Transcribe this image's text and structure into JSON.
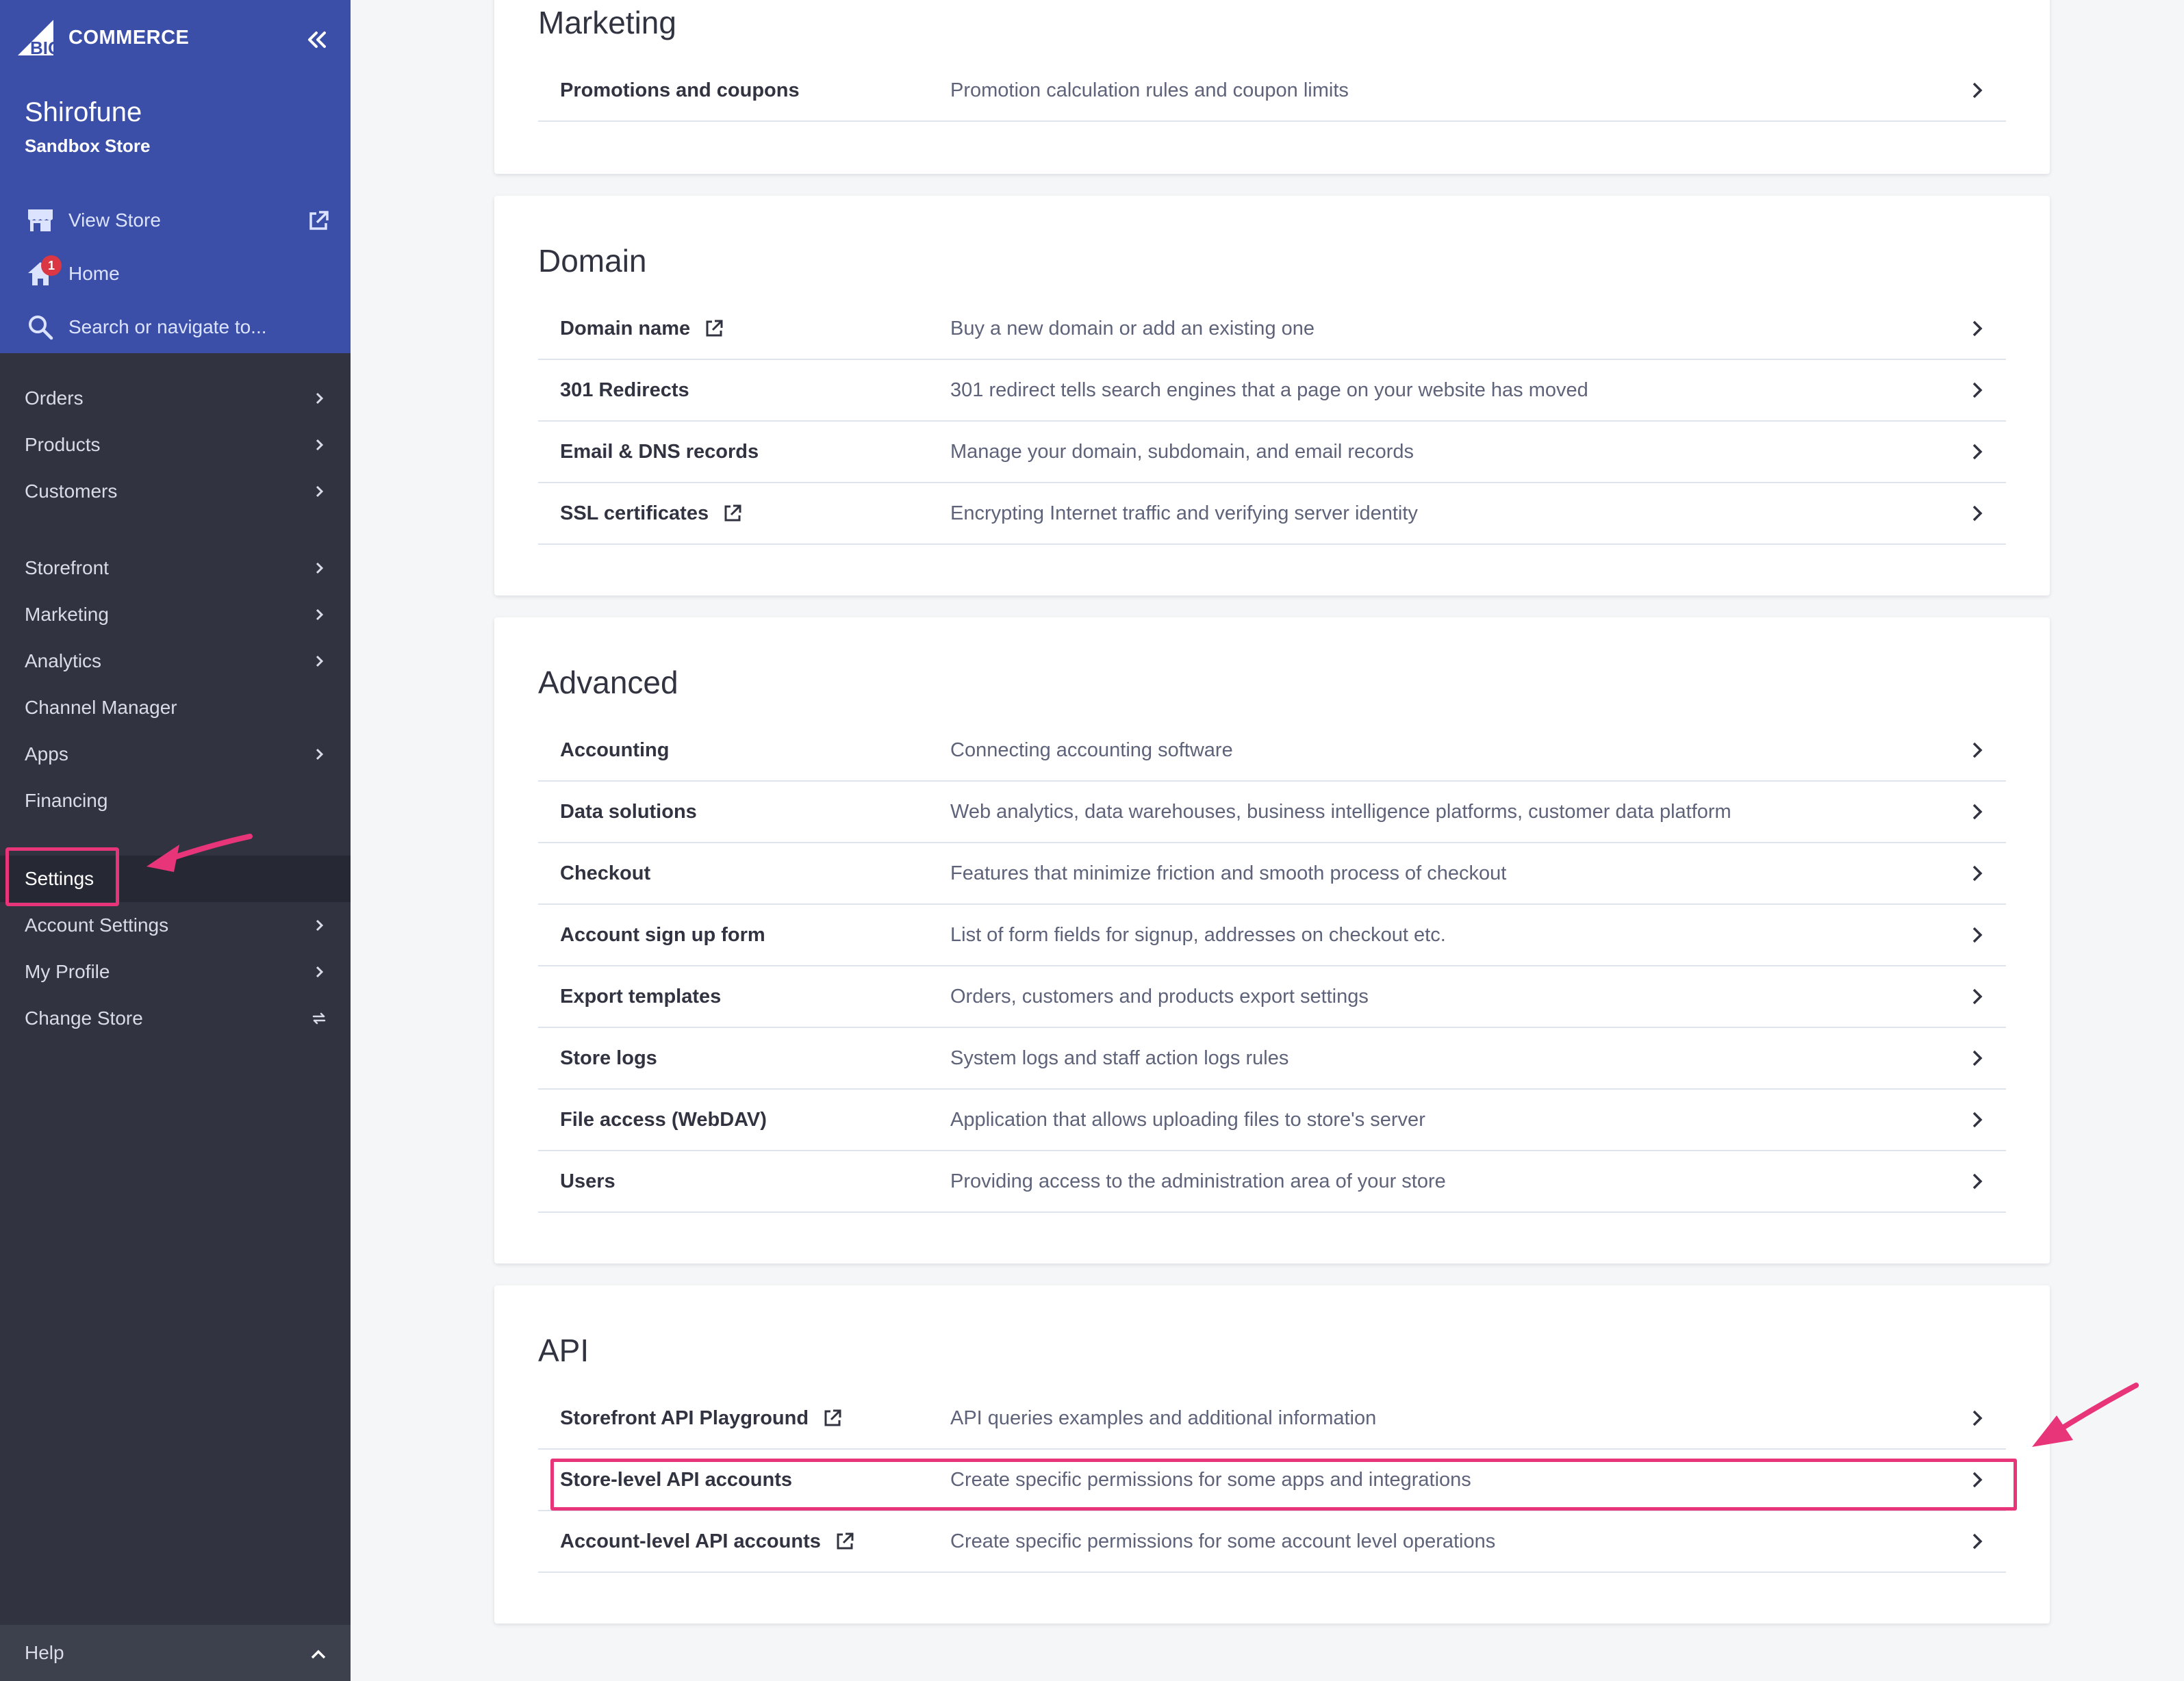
{
  "sidebar": {
    "logo_text": "COMMERCE",
    "logo_mark": "BIG",
    "store_name": "Shirofune",
    "store_subtitle": "Sandbox Store",
    "view_store": "View Store",
    "home": "Home",
    "home_badge": "1",
    "search_placeholder": "Search or navigate to...",
    "nav": [
      {
        "label": "Orders"
      },
      {
        "label": "Products"
      },
      {
        "label": "Customers"
      },
      {
        "label": "Storefront"
      },
      {
        "label": "Marketing"
      },
      {
        "label": "Analytics"
      },
      {
        "label": "Channel Manager"
      },
      {
        "label": "Apps"
      },
      {
        "label": "Financing"
      },
      {
        "label": "Settings"
      },
      {
        "label": "Account Settings"
      },
      {
        "label": "My Profile"
      },
      {
        "label": "Change Store"
      }
    ],
    "help": "Help"
  },
  "sections": {
    "marketing": {
      "title": "Marketing",
      "rows": [
        {
          "name": "Promotions and coupons",
          "desc": "Promotion calculation rules and coupon limits"
        }
      ]
    },
    "domain": {
      "title": "Domain",
      "rows": [
        {
          "name": "Domain name",
          "desc": "Buy a new domain or add an existing one"
        },
        {
          "name": "301 Redirects",
          "desc": "301 redirect tells search engines that a page on your website has moved"
        },
        {
          "name": "Email & DNS records",
          "desc": "Manage your domain, subdomain, and email records"
        },
        {
          "name": "SSL certificates",
          "desc": "Encrypting Internet traffic and verifying server identity"
        }
      ]
    },
    "advanced": {
      "title": "Advanced",
      "rows": [
        {
          "name": "Accounting",
          "desc": "Connecting accounting software"
        },
        {
          "name": "Data solutions",
          "desc": "Web analytics, data warehouses, business intelligence platforms, customer data platform"
        },
        {
          "name": "Checkout",
          "desc": "Features that minimize friction and smooth process of checkout"
        },
        {
          "name": "Account sign up form",
          "desc": "List of form fields for signup, addresses on checkout etc."
        },
        {
          "name": "Export templates",
          "desc": "Orders, customers and products export settings"
        },
        {
          "name": "Store logs",
          "desc": "System logs and staff action logs rules"
        },
        {
          "name": "File access (WebDAV)",
          "desc": "Application that allows uploading files to store's server"
        },
        {
          "name": "Users",
          "desc": "Providing access to the administration area of your store"
        }
      ]
    },
    "api": {
      "title": "API",
      "rows": [
        {
          "name": "Storefront API Playground",
          "desc": "API queries examples and additional information"
        },
        {
          "name": "Store-level API accounts",
          "desc": "Create specific permissions for some apps and integrations"
        },
        {
          "name": "Account-level API accounts",
          "desc": "Create specific permissions for some account level operations"
        }
      ]
    }
  },
  "colors": {
    "sidebar_top": "#3c4fa8",
    "sidebar": "#313440",
    "annotation": "#e8357a"
  }
}
